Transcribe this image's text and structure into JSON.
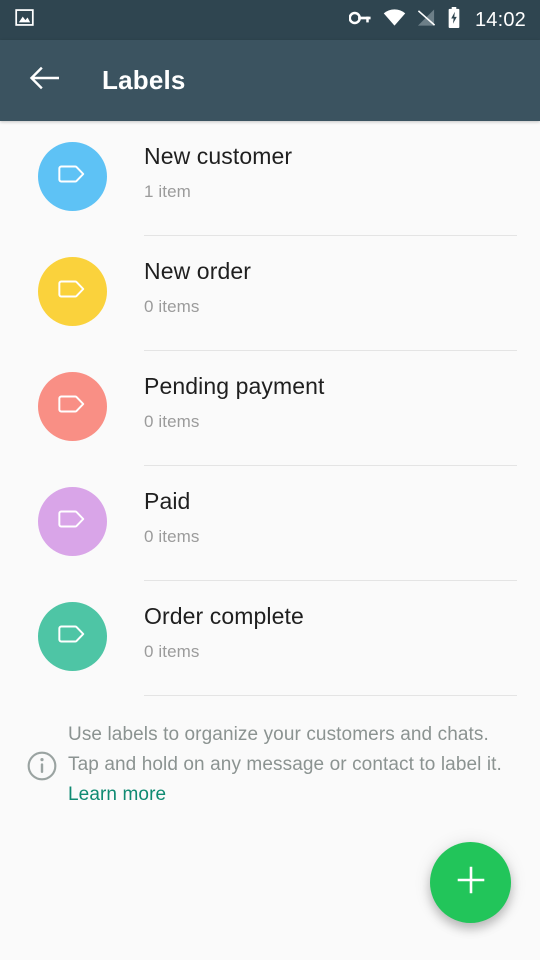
{
  "status_bar": {
    "notification_icon": "image-icon",
    "icons": [
      "vpn-key-icon",
      "wifi-icon",
      "no-sim-signal-icon",
      "battery-charging-icon"
    ],
    "time": "14:02",
    "background_color": "#2f4550"
  },
  "app_bar": {
    "back_icon": "arrow-back-icon",
    "title": "Labels",
    "background_color": "#3b5360"
  },
  "labels": [
    {
      "name": "New customer",
      "count_text": "1 item",
      "color": "#5ec2f5",
      "icon": "label-tag-icon"
    },
    {
      "name": "New order",
      "count_text": "0 items",
      "color": "#fad23c",
      "icon": "label-tag-icon"
    },
    {
      "name": "Pending payment",
      "count_text": "0 items",
      "color": "#f98f85",
      "icon": "label-tag-icon"
    },
    {
      "name": "Paid",
      "count_text": "0 items",
      "color": "#d9a5e8",
      "icon": "label-tag-icon"
    },
    {
      "name": "Order complete",
      "count_text": "0 items",
      "color": "#4ec5a5",
      "icon": "label-tag-icon"
    }
  ],
  "info": {
    "icon": "info-circle-icon",
    "text": "Use labels to organize your customers and chats. Tap and hold on any message or contact to label it.",
    "link_label": "Learn more",
    "link_color": "#0f8a72"
  },
  "fab": {
    "icon": "plus-icon",
    "color": "#22c55a",
    "label": "Add label"
  }
}
